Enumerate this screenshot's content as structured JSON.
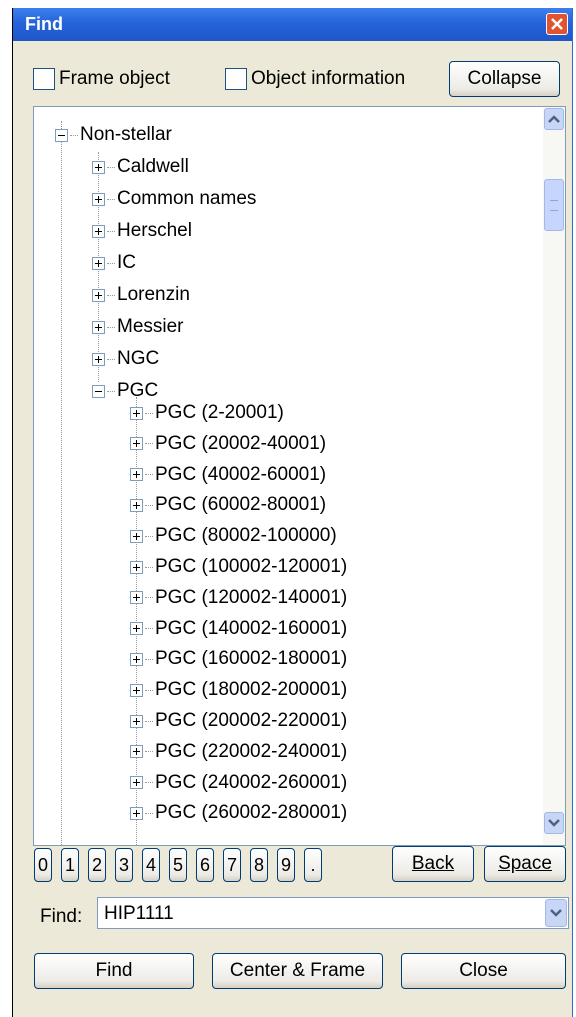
{
  "window": {
    "title": "Find"
  },
  "options": {
    "frame_object": {
      "label": "Frame object",
      "checked": false
    },
    "object_information": {
      "label": "Object information",
      "checked": false
    },
    "collapse_label": "Collapse"
  },
  "tree": {
    "root": {
      "label": "Non-stellar",
      "expanded": true
    },
    "groups": [
      {
        "label": "Caldwell",
        "expanded": false
      },
      {
        "label": "Common names",
        "expanded": false
      },
      {
        "label": "Herschel",
        "expanded": false
      },
      {
        "label": "IC",
        "expanded": false
      },
      {
        "label": "Lorenzin",
        "expanded": false
      },
      {
        "label": "Messier",
        "expanded": false
      },
      {
        "label": "NGC",
        "expanded": false
      },
      {
        "label": "PGC",
        "expanded": true
      }
    ],
    "pgc_children": [
      "PGC (2-20001)",
      "PGC (20002-40001)",
      "PGC (40002-60001)",
      "PGC (60002-80001)",
      "PGC (80002-100000)",
      "PGC (100002-120001)",
      "PGC (120002-140001)",
      "PGC (140002-160001)",
      "PGC (160002-180001)",
      "PGC (180002-200001)",
      "PGC (200002-220001)",
      "PGC (220002-240001)",
      "PGC (240002-260001)",
      "PGC (260002-280001)"
    ]
  },
  "keypad": {
    "keys": [
      "0",
      "1",
      "2",
      "3",
      "4",
      "5",
      "6",
      "7",
      "8",
      "9",
      "."
    ],
    "back_label": "Back",
    "space_label": "Space"
  },
  "find": {
    "label": "Find:",
    "value": "HIP1111"
  },
  "actions": {
    "find_label": "Find",
    "center_frame_label": "Center & Frame",
    "close_label": "Close"
  }
}
